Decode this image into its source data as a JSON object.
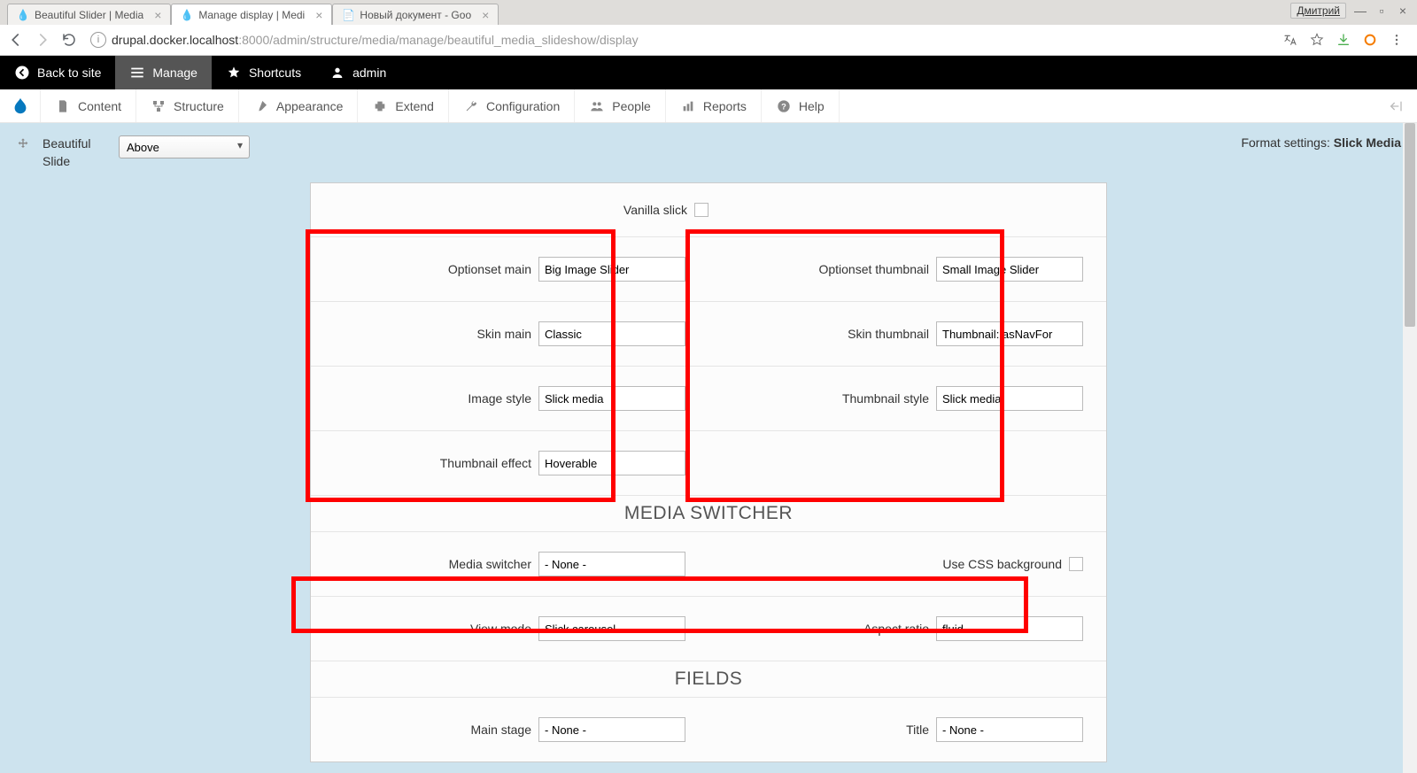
{
  "browser": {
    "tabs": [
      {
        "label": "Beautiful Slider | Media",
        "icon": "💧"
      },
      {
        "label": "Manage display | Medi",
        "icon": "💧"
      },
      {
        "label": "Новый документ - Goo",
        "icon": "📄"
      }
    ],
    "active_tab_index": 1,
    "user_badge": "Дмитрий",
    "url_host": "drupal.docker.localhost",
    "url_path": ":8000/admin/structure/media/manage/beautiful_media_slideshow/display"
  },
  "drupal_toolbar": {
    "back_to_site": "Back to site",
    "manage": "Manage",
    "shortcuts": "Shortcuts",
    "admin": "admin"
  },
  "admin_menu": {
    "content": "Content",
    "structure": "Structure",
    "appearance": "Appearance",
    "extend": "Extend",
    "configuration": "Configuration",
    "people": "People",
    "reports": "Reports",
    "help": "Help"
  },
  "field_header": {
    "field_name_line1": "Beautiful",
    "field_name_line2": "Slide",
    "label_select_value": "Above",
    "format_settings_prefix": "Format settings: ",
    "format_settings_value": "Slick Media"
  },
  "form": {
    "vanilla_slick_label": "Vanilla slick",
    "left": {
      "optionset_main": {
        "label": "Optionset main",
        "value": "Big Image Slider"
      },
      "skin_main": {
        "label": "Skin main",
        "value": "Classic"
      },
      "image_style": {
        "label": "Image style",
        "value": "Slick media"
      },
      "thumbnail_effect": {
        "label": "Thumbnail effect",
        "value": "Hoverable"
      }
    },
    "right": {
      "optionset_thumbnail": {
        "label": "Optionset thumbnail",
        "value": "Small Image Slider"
      },
      "skin_thumbnail": {
        "label": "Skin thumbnail",
        "value": "Thumbnail: asNavFor"
      },
      "thumbnail_style": {
        "label": "Thumbnail style",
        "value": "Slick media"
      }
    },
    "section_media_switcher": "MEDIA SWITCHER",
    "media_switcher": {
      "label": "Media switcher",
      "value": "- None -"
    },
    "use_css_bg": {
      "label": "Use CSS background"
    },
    "view_mode": {
      "label": "View mode",
      "value": "Slick carousel"
    },
    "aspect_ratio": {
      "label": "Aspect ratio",
      "value": "fluid"
    },
    "section_fields": "FIELDS",
    "main_stage": {
      "label": "Main stage",
      "value": "- None -"
    },
    "title": {
      "label": "Title",
      "value": "- None -"
    }
  }
}
